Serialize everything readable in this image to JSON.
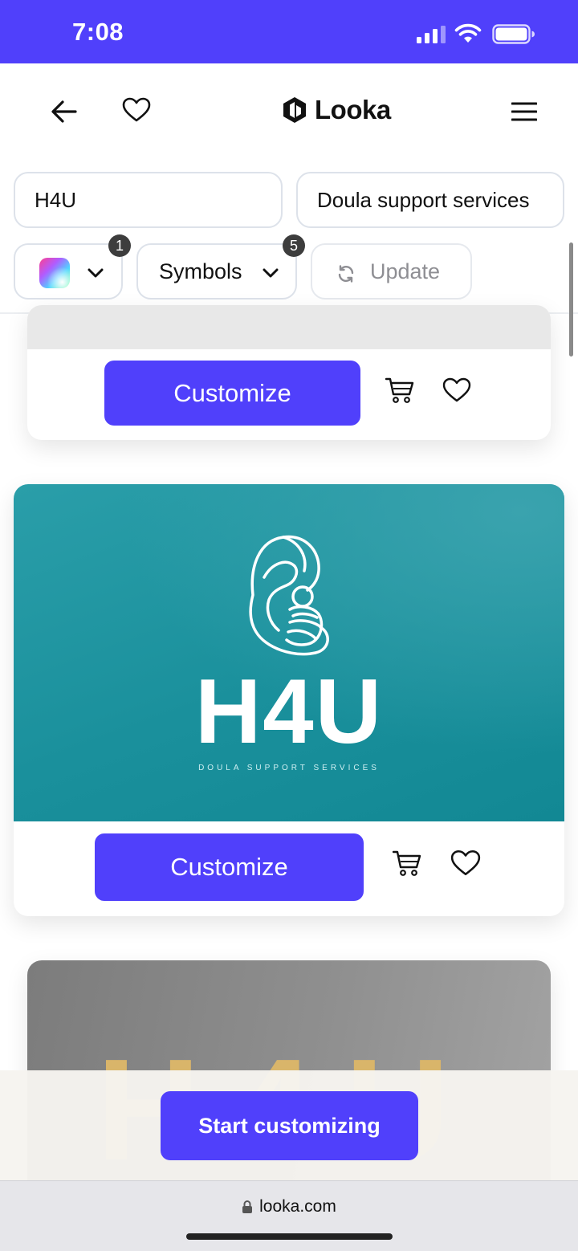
{
  "status_bar": {
    "time": "7:08"
  },
  "nav": {
    "back": "back-arrow-icon",
    "favorite": "heart-icon",
    "brand": "Looka",
    "menu": "hamburger-menu-icon"
  },
  "search": {
    "company_name": "H4U",
    "industry": "Doula support services"
  },
  "filters": {
    "color_badge": "1",
    "symbols_label": "Symbols",
    "symbols_badge": "5",
    "update_label": "Update"
  },
  "cards": [
    {
      "customize_label": "Customize"
    },
    {
      "customize_label": "Customize",
      "logo_name": "H4U",
      "logo_tagline": "DOULA SUPPORT SERVICES",
      "background_color": "#1a909c"
    },
    {
      "logo_name": "H4U"
    }
  ],
  "bottom": {
    "start_label": "Start customizing"
  },
  "browser": {
    "url": "looka.com"
  },
  "colors": {
    "accent": "#5040fb",
    "teal": "#1a909c",
    "gold": "#c7a15c"
  }
}
